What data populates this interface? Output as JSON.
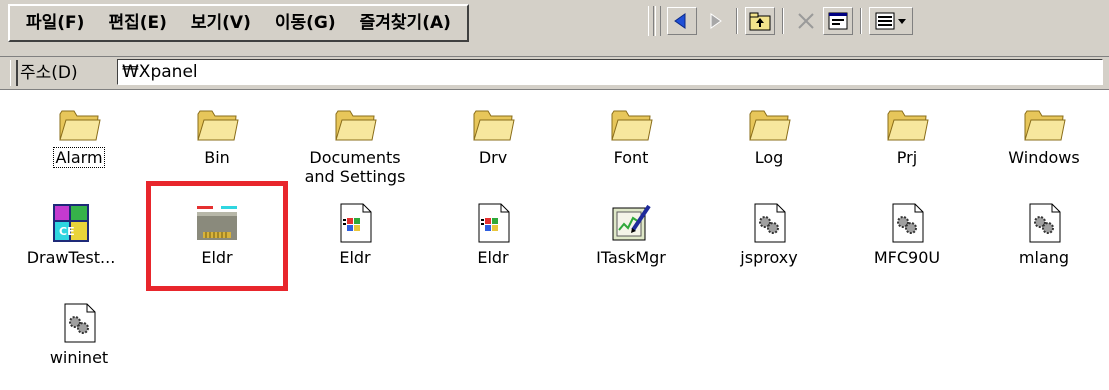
{
  "menu": {
    "items": [
      "파일(F)",
      "편집(E)",
      "보기(V)",
      "이동(G)",
      "즐겨찾기(A)"
    ]
  },
  "toolbar": {
    "buttons": [
      "back-icon",
      "forward-icon",
      "up-folder-icon",
      "delete-icon",
      "properties-icon",
      "views-icon"
    ]
  },
  "address": {
    "label": "주소(D)",
    "value": "₩Xpanel"
  },
  "files": [
    {
      "name": "Alarm",
      "icon": "folder-icon"
    },
    {
      "name": "Bin",
      "icon": "folder-icon"
    },
    {
      "name": "Documents\nand Settings",
      "icon": "folder-icon"
    },
    {
      "name": "Drv",
      "icon": "folder-icon"
    },
    {
      "name": "Font",
      "icon": "folder-icon"
    },
    {
      "name": "Log",
      "icon": "folder-icon"
    },
    {
      "name": "Prj",
      "icon": "folder-icon"
    },
    {
      "name": "Windows",
      "icon": "folder-icon"
    },
    {
      "name": "DrawTest...",
      "icon": "mfc-app-icon"
    },
    {
      "name": "Eldr",
      "icon": "network-port-icon"
    },
    {
      "name": "Eldr",
      "icon": "windows-exe-icon"
    },
    {
      "name": "Eldr",
      "icon": "windows-exe-icon"
    },
    {
      "name": "ITaskMgr",
      "icon": "task-manager-icon"
    },
    {
      "name": "jsproxy",
      "icon": "dll-gear-icon"
    },
    {
      "name": "MFC90U",
      "icon": "dll-gear-icon"
    },
    {
      "name": "mlang",
      "icon": "dll-gear-icon"
    },
    {
      "name": "wininet",
      "icon": "dll-gear-icon"
    }
  ],
  "colors": {
    "chrome": "#d4d0c8",
    "highlight_border": "#e8262c",
    "folder": "#f5e08a"
  }
}
